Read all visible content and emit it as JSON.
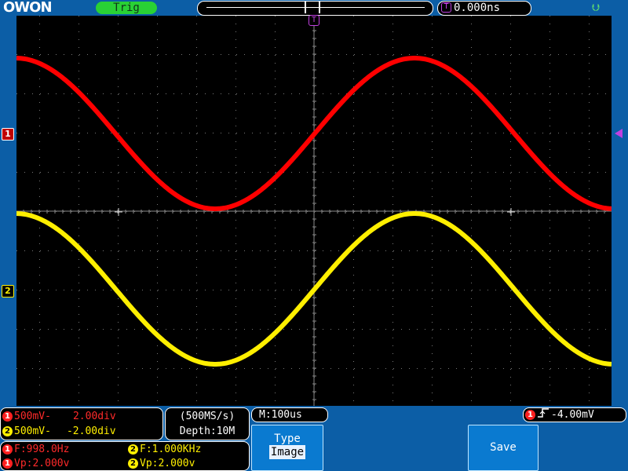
{
  "header": {
    "logo": "OWON",
    "trigger_status": "Trig",
    "trigger_offset": "0.000ns",
    "trig_icon": "T",
    "usb_icon": "usb-icon"
  },
  "markers": {
    "ch1": "1",
    "ch2": "2",
    "trig_pos": "T"
  },
  "channels": [
    {
      "id": "1",
      "scale": "500mV-",
      "position": "2.00div",
      "color": "#ff0000"
    },
    {
      "id": "2",
      "scale": "500mV-",
      "position": "-2.00div",
      "color": "#ffef00"
    }
  ],
  "acquisition": {
    "sample_rate": "(500MS/s)",
    "depth": "Depth:10M"
  },
  "timebase": "M:100us",
  "trigger": {
    "channel": "1",
    "edge_icon": "rising-edge-icon",
    "level": "-4.00mV"
  },
  "measurements": {
    "ch1_freq": "F:998.0Hz",
    "ch2_freq": "F:1.000KHz",
    "ch1_vp": "Vp:2.000v",
    "ch2_vp": "Vp:2.000v"
  },
  "softkeys": {
    "type_label": "Type",
    "type_value": "Image",
    "save_label": "Save"
  }
}
